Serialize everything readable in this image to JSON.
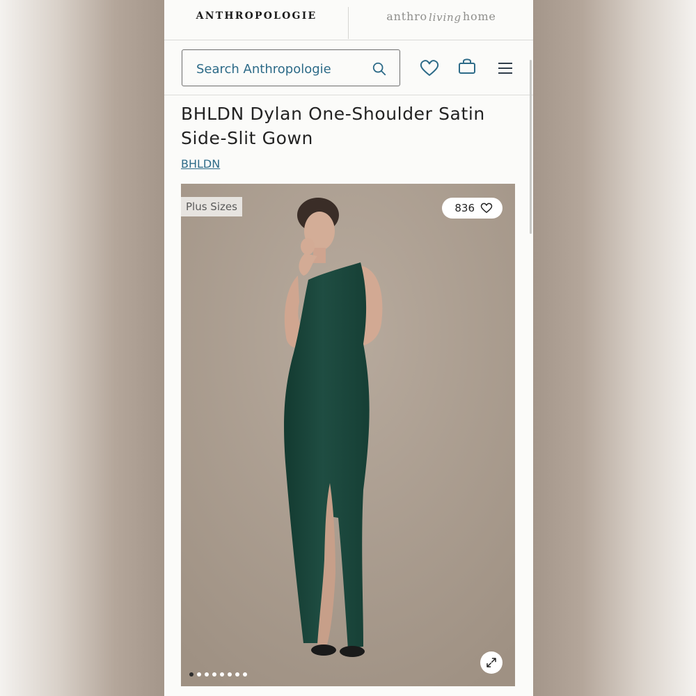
{
  "brands": {
    "primary": "ANTHROPOLOGIE",
    "secondary_left": "anthro",
    "secondary_script": "living",
    "secondary_right": "home"
  },
  "search": {
    "placeholder": "Search Anthropologie",
    "icon": "search-icon"
  },
  "header_icons": [
    "heart-icon",
    "bag-icon",
    "menu-icon"
  ],
  "product": {
    "title": "BHLDN Dylan One-Shoulder Satin Side-Slit Gown",
    "brand_link": "BHLDN",
    "badge": "Plus Sizes",
    "likes": "836",
    "image_count": 8,
    "active_image": 0,
    "dress_color": "#1f4d42"
  },
  "colors": {
    "accent": "#2d6b88",
    "text": "#232323",
    "background": "#fbfbf9"
  }
}
